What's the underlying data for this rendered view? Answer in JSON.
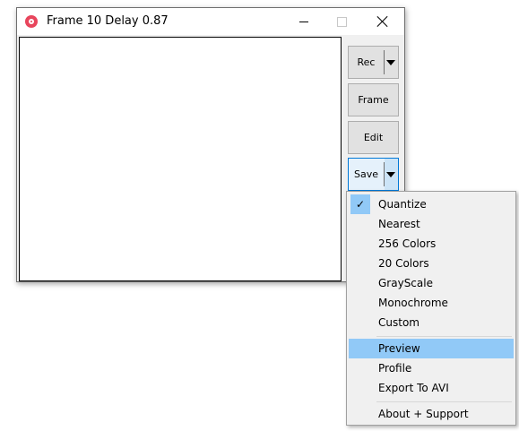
{
  "window": {
    "title": "Frame 10 Delay 0.87"
  },
  "buttons": {
    "rec": "Rec",
    "frame": "Frame",
    "edit": "Edit",
    "save": "Save"
  },
  "menu": {
    "items": [
      {
        "label": "Quantize",
        "checked": true
      },
      {
        "label": "Nearest"
      },
      {
        "label": "256 Colors"
      },
      {
        "label": "20 Colors"
      },
      {
        "label": "GrayScale"
      },
      {
        "label": "Monochrome"
      },
      {
        "label": "Custom"
      },
      {
        "label": "Preview",
        "highlighted": true
      },
      {
        "label": "Profile"
      },
      {
        "label": "Export To AVI"
      },
      {
        "label": "About + Support"
      }
    ],
    "check_glyph": "✓"
  },
  "colors": {
    "accent": "#0078d7",
    "highlight": "#91c9f7",
    "app_icon": "#e8455c"
  }
}
